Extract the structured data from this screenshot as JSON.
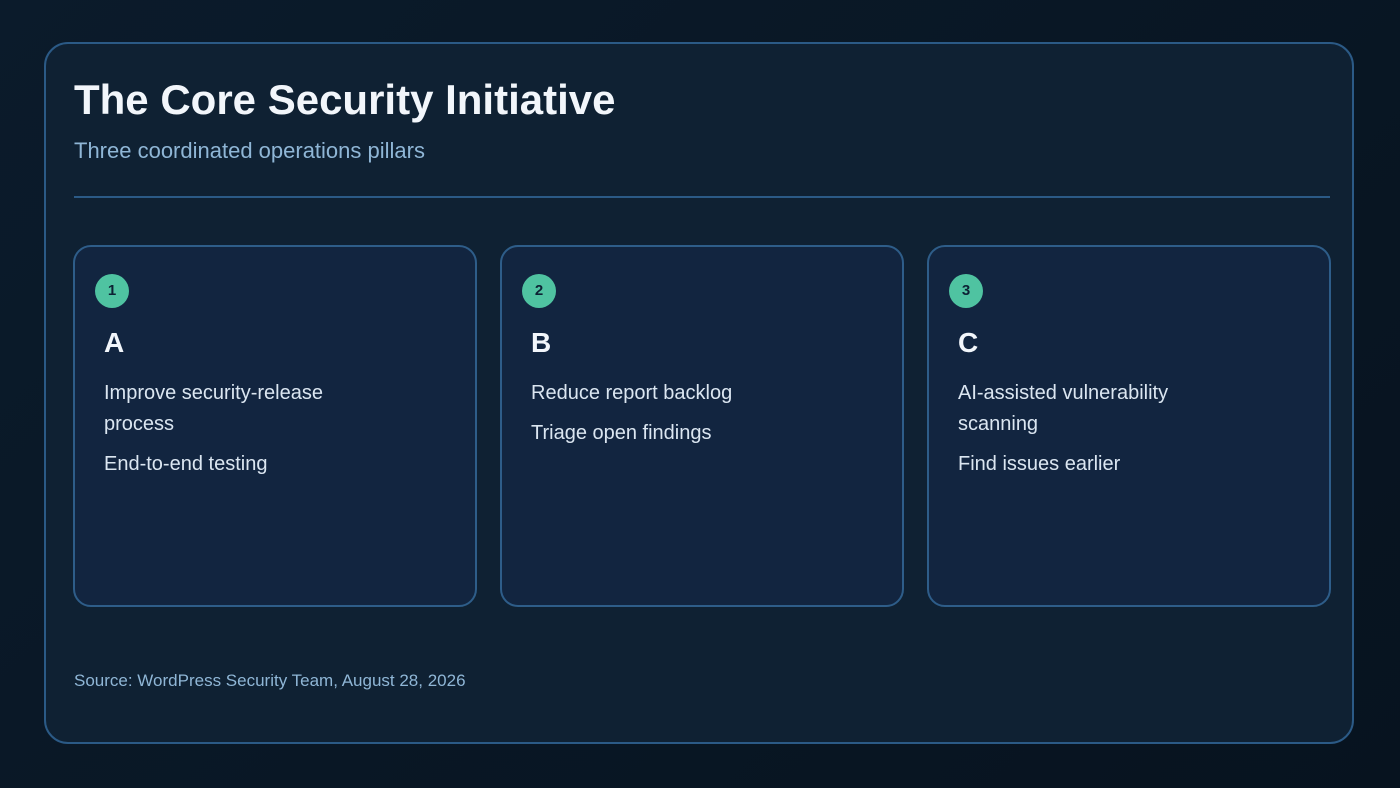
{
  "header": {
    "title": "The Core Security Initiative",
    "subtitle": "Three coordinated operations pillars"
  },
  "pillars": [
    {
      "number": "1",
      "title": "A",
      "items": [
        "Improve security-release process",
        "End-to-end testing"
      ]
    },
    {
      "number": "2",
      "title": "B",
      "items": [
        "Reduce report backlog",
        "Triage open findings"
      ]
    },
    {
      "number": "3",
      "title": "C",
      "items": [
        "AI-assisted vulnerability scanning",
        "Find issues earlier"
      ]
    }
  ],
  "footer": {
    "source": "Source: WordPress Security Team, August 28, 2026"
  },
  "colors": {
    "background": "#0b1b2b",
    "panel": "#0f2133",
    "border": "#2b5a86",
    "card": "#122540",
    "accent": "#4fc3a1",
    "title_text": "#f2f6fb",
    "muted_text": "#8fb6d6"
  }
}
